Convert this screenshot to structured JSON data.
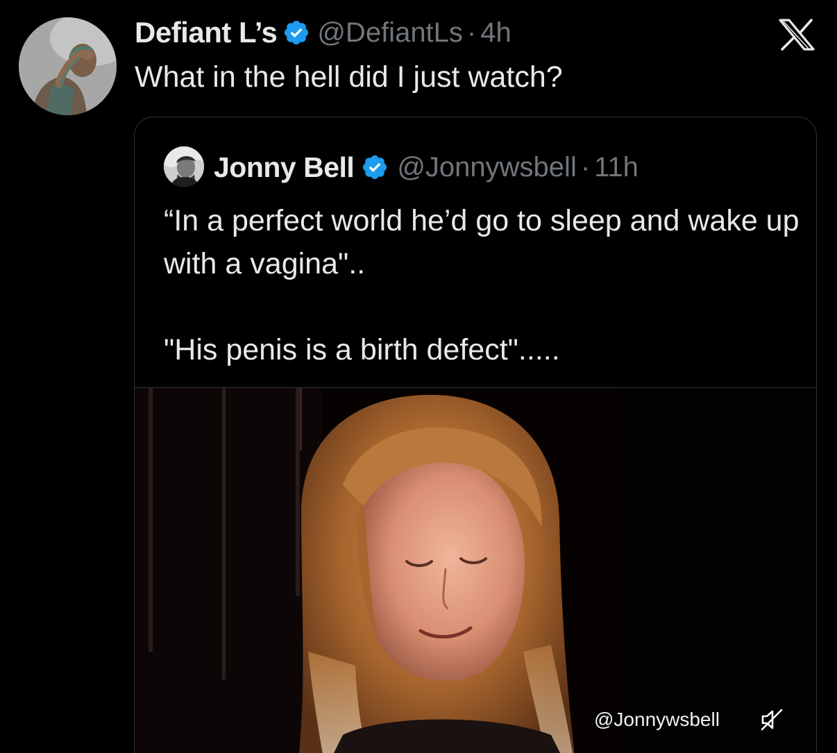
{
  "tweet": {
    "author": {
      "display_name": "Defiant L’s",
      "handle": "@DefiantLs",
      "verified": true,
      "avatar_icon": "facepalm-statue-avatar"
    },
    "separator": "·",
    "time": "4h",
    "text": "What in the hell did I just watch?"
  },
  "brand": {
    "logo_icon": "x-logo-icon"
  },
  "quoted_tweet": {
    "author": {
      "display_name": "Jonny Bell",
      "handle": "@Jonnywsbell",
      "verified": true,
      "avatar_icon": "profile-photo-avatar"
    },
    "separator": "·",
    "time": "11h",
    "text": "“In a perfect world he’d go to sleep and wake up with a vagina\"..\n\n\"His penis is a birth defect\".....",
    "media": {
      "type": "video",
      "watermark": "@Jonnywsbell",
      "muted_icon": "speaker-muted-icon"
    }
  },
  "colors": {
    "background": "#000000",
    "text_primary": "#e7e9ea",
    "text_secondary": "#71767b",
    "verified_badge": "#1d9bf0",
    "border": "#2f3336"
  }
}
